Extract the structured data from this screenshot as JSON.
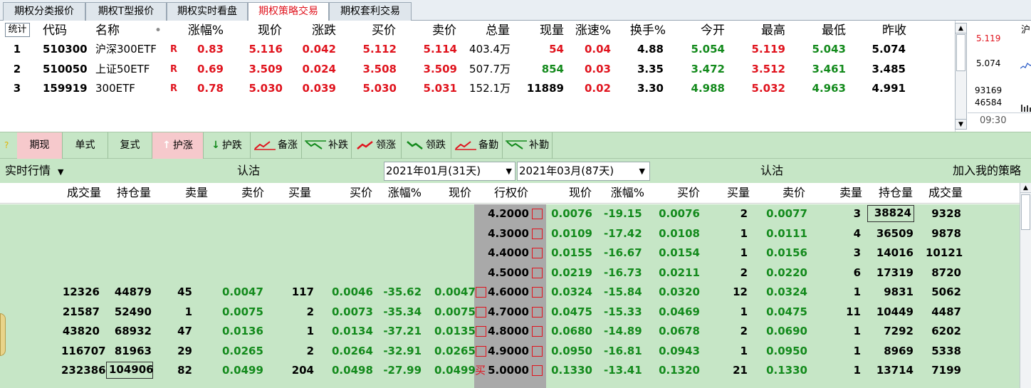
{
  "tabs": [
    "期权分类报价",
    "期权T型报价",
    "期权实时看盘",
    "期权策略交易",
    "期权套利交易"
  ],
  "active_tab": 3,
  "quote": {
    "stat_label": "统计",
    "headers": [
      "代码",
      "名称",
      "•",
      "涨幅%",
      "现价",
      "涨跌",
      "买价",
      "卖价",
      "总量",
      "现量",
      "涨速%",
      "换手%",
      "今开",
      "最高",
      "最低",
      "昨收"
    ],
    "rows": [
      {
        "no": "1",
        "code": "510300",
        "name": "沪深300ETF",
        "mark": "R",
        "chg_pct": "0.83",
        "price": "5.116",
        "chg": "0.042",
        "bid": "5.112",
        "ask": "5.114",
        "vol": "403.4万",
        "cur": "54",
        "speed": "0.04",
        "turnover": "4.88",
        "open": "5.054",
        "high": "5.119",
        "low": "5.043",
        "prev": "5.074"
      },
      {
        "no": "2",
        "code": "510050",
        "name": "上证50ETF",
        "mark": "R",
        "chg_pct": "0.69",
        "price": "3.509",
        "chg": "0.024",
        "bid": "3.508",
        "ask": "3.509",
        "vol": "507.7万",
        "cur": "854",
        "speed": "0.03",
        "turnover": "3.35",
        "open": "3.472",
        "high": "3.512",
        "low": "3.461",
        "prev": "3.485"
      },
      {
        "no": "3",
        "code": "159919",
        "name": "300ETF",
        "mark": "R",
        "chg_pct": "0.78",
        "price": "5.030",
        "chg": "0.039",
        "bid": "5.030",
        "ask": "5.031",
        "vol": "152.1万",
        "cur": "11889",
        "speed": "0.02",
        "turnover": "3.30",
        "open": "4.988",
        "high": "5.032",
        "low": "4.963",
        "prev": "4.991"
      }
    ]
  },
  "mini_panel": {
    "title": "沪",
    "v1": "5.119",
    "v2": "5.074",
    "v3": "93169",
    "v4": "46584",
    "time": "09:30"
  },
  "strategy_bar": [
    "期现",
    "单式",
    "复式",
    "护涨",
    "护跌",
    "备涨",
    "补跌",
    "领涨",
    "领跌",
    "备勤",
    "补勤"
  ],
  "chain_header": {
    "market": "实时行情",
    "left_label": "认沽",
    "date1": "2021年01月(31天)",
    "date2": "2021年03月(87天)",
    "right_label": "认沽",
    "add_label": "加入我的策略"
  },
  "columns": [
    "成交量",
    "持仓量",
    "卖量",
    "卖价",
    "买量",
    "买价",
    "涨幅%",
    "现价",
    "行权价",
    "现价",
    "涨幅%",
    "买价",
    "买量",
    "卖价",
    "卖量",
    "持仓量",
    "成交量"
  ],
  "chain_rows": [
    {
      "l": [
        "",
        "",
        "",
        "",
        "",
        "",
        "",
        ""
      ],
      "lbox": false,
      "strike": "4.2000",
      "r": [
        "0.0076",
        "-19.15",
        "0.0076",
        "2",
        "0.0077",
        "3",
        "38824",
        "9328"
      ],
      "rbox": true
    },
    {
      "l": [
        "",
        "",
        "",
        "",
        "",
        "",
        "",
        ""
      ],
      "lbox": false,
      "strike": "4.3000",
      "r": [
        "0.0109",
        "-17.42",
        "0.0108",
        "1",
        "0.0111",
        "4",
        "36509",
        "9878"
      ],
      "rbox": false
    },
    {
      "l": [
        "",
        "",
        "",
        "",
        "",
        "",
        "",
        ""
      ],
      "lbox": false,
      "strike": "4.4000",
      "r": [
        "0.0155",
        "-16.67",
        "0.0154",
        "1",
        "0.0156",
        "3",
        "14016",
        "10121"
      ],
      "rbox": false
    },
    {
      "l": [
        "",
        "",
        "",
        "",
        "",
        "",
        "",
        ""
      ],
      "lbox": false,
      "strike": "4.5000",
      "r": [
        "0.0219",
        "-16.73",
        "0.0211",
        "2",
        "0.0220",
        "6",
        "17319",
        "8720"
      ],
      "rbox": false
    },
    {
      "l": [
        "12326",
        "44879",
        "45",
        "0.0047",
        "117",
        "0.0046",
        "-35.62",
        "0.0047"
      ],
      "lbox": true,
      "strike": "4.6000",
      "r": [
        "0.0324",
        "-15.84",
        "0.0320",
        "12",
        "0.0324",
        "1",
        "9831",
        "5062"
      ],
      "rbox": false
    },
    {
      "l": [
        "21587",
        "52490",
        "1",
        "0.0075",
        "2",
        "0.0073",
        "-35.34",
        "0.0075"
      ],
      "lbox": true,
      "strike": "4.7000",
      "r": [
        "0.0475",
        "-15.33",
        "0.0469",
        "1",
        "0.0475",
        "11",
        "10449",
        "4487"
      ],
      "rbox": false
    },
    {
      "l": [
        "43820",
        "68932",
        "47",
        "0.0136",
        "1",
        "0.0134",
        "-37.21",
        "0.0135"
      ],
      "lbox": true,
      "strike": "4.8000",
      "r": [
        "0.0680",
        "-14.89",
        "0.0678",
        "2",
        "0.0690",
        "1",
        "7292",
        "6202"
      ],
      "rbox": false
    },
    {
      "l": [
        "116707",
        "81963",
        "29",
        "0.0265",
        "2",
        "0.0264",
        "-32.91",
        "0.0265"
      ],
      "lbox": true,
      "strike": "4.9000",
      "r": [
        "0.0950",
        "-16.81",
        "0.0943",
        "1",
        "0.0950",
        "1",
        "8969",
        "5338"
      ],
      "rbox": false
    },
    {
      "l": [
        "232386",
        "104906",
        "82",
        "0.0499",
        "204",
        "0.0498",
        "-27.99",
        "0.0499"
      ],
      "lbox": false,
      "buy_mark": "买",
      "strike": "5.0000",
      "r": [
        "0.1330",
        "-13.41",
        "0.1320",
        "21",
        "0.1330",
        "1",
        "13714",
        "7199"
      ],
      "rbox": false,
      "lboxed": true
    }
  ],
  "colors": {
    "accent": "#e0141e",
    "green": "#138a1c",
    "grid_bg": "#c6e6c6",
    "strike_bg": "#a9a9a9"
  }
}
